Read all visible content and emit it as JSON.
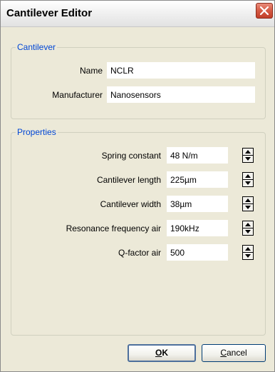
{
  "window": {
    "title": "Cantilever Editor"
  },
  "cantilever_group": {
    "legend": "Cantilever",
    "name_label": "Name",
    "name_value": "NCLR",
    "manufacturer_label": "Manufacturer",
    "manufacturer_value": "Nanosensors"
  },
  "properties_group": {
    "legend": "Properties",
    "rows": [
      {
        "label": "Spring constant",
        "value": "48 N/m"
      },
      {
        "label": "Cantilever length",
        "value": "225µm"
      },
      {
        "label": "Cantilever width",
        "value": "38µm"
      },
      {
        "label": "Resonance frequency air",
        "value": "190kHz"
      },
      {
        "label": "Q-factor air",
        "value": "500"
      }
    ]
  },
  "buttons": {
    "ok": {
      "accel": "O",
      "rest": "K"
    },
    "cancel": {
      "accel": "C",
      "rest": "ancel"
    }
  },
  "icons": {
    "close": "close-icon",
    "spin_up": "arrow-up-icon",
    "spin_down": "arrow-down-icon"
  }
}
